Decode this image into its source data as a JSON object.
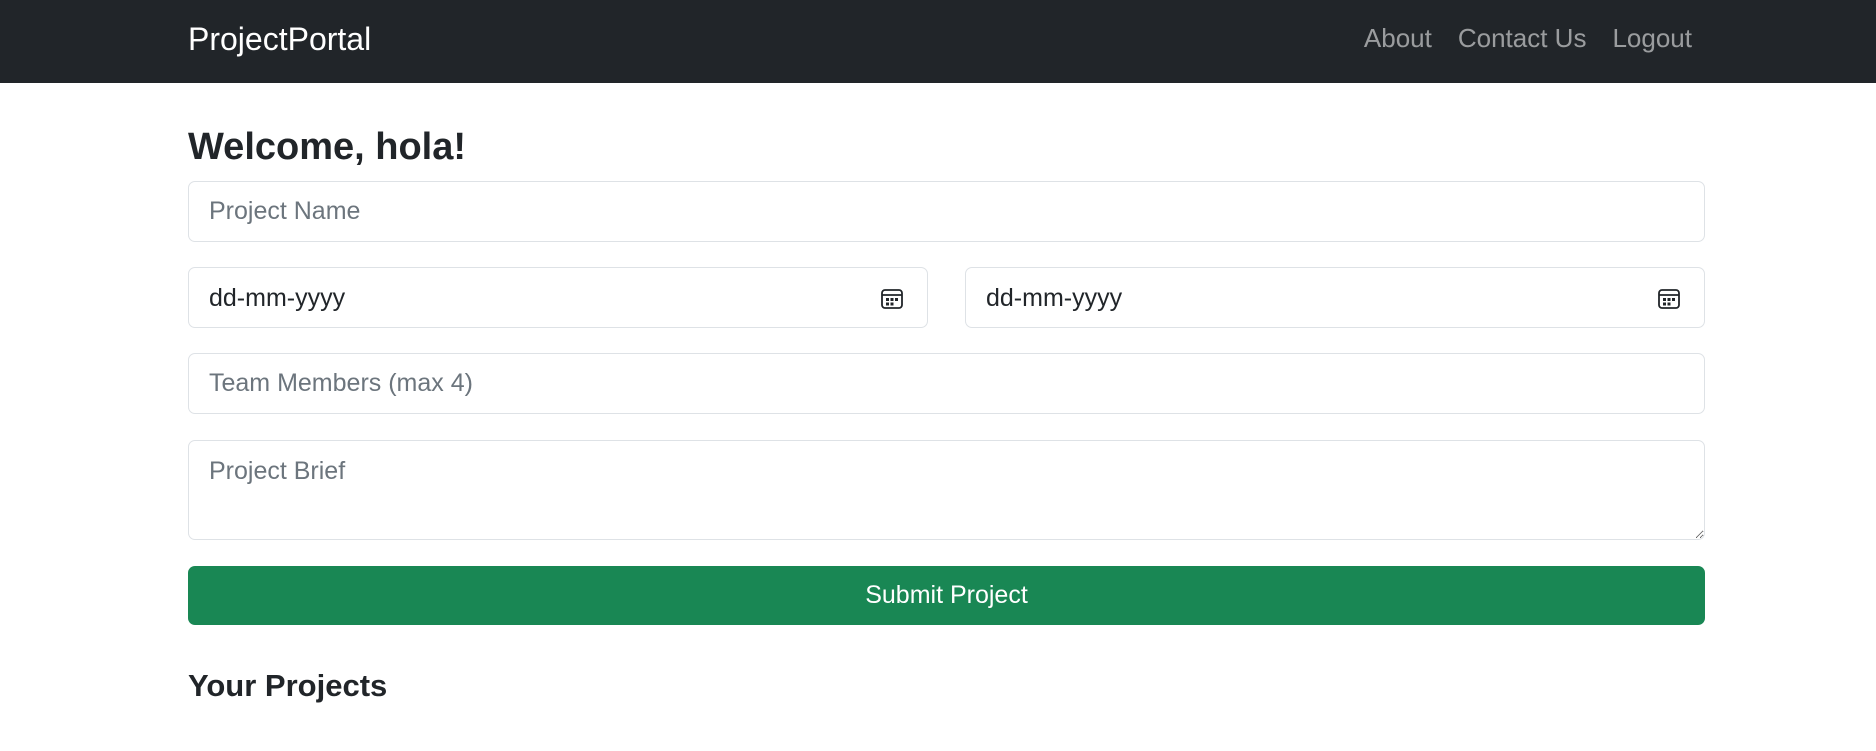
{
  "navbar": {
    "brand": "ProjectPortal",
    "links": [
      {
        "label": "About"
      },
      {
        "label": "Contact Us"
      },
      {
        "label": "Logout"
      }
    ]
  },
  "main": {
    "welcome": "Welcome, hola!",
    "form": {
      "project_name": {
        "placeholder": "Project Name",
        "value": ""
      },
      "start_date": {
        "display": "dd-mm-yyyy",
        "icon": "calendar-icon"
      },
      "end_date": {
        "display": "dd-mm-yyyy",
        "icon": "calendar-icon"
      },
      "team_members": {
        "placeholder": "Team Members (max 4)",
        "value": ""
      },
      "project_brief": {
        "placeholder": "Project Brief",
        "value": ""
      },
      "submit_label": "Submit Project"
    },
    "projects_heading": "Your Projects"
  },
  "colors": {
    "navbar_bg": "#212529",
    "submit_bg": "#198754"
  }
}
